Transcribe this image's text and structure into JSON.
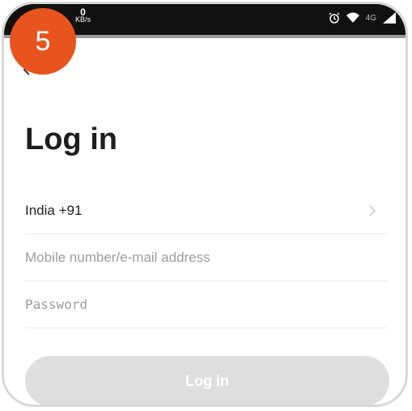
{
  "step_badge": "5",
  "status_bar": {
    "network_speed_value": "0",
    "network_speed_unit": "KB/s",
    "network_type": "4G",
    "icons": [
      "alarm-icon",
      "wifi-icon",
      "signal-icon"
    ]
  },
  "page": {
    "title": "Log in"
  },
  "form": {
    "country_label": "India +91",
    "mobile_placeholder": "Mobile number/e-mail address",
    "password_placeholder": "Password",
    "login_label": "Log in"
  },
  "colors": {
    "badge": "#e8541e",
    "status_bar": "#111111",
    "button_disabled": "#dedede"
  }
}
